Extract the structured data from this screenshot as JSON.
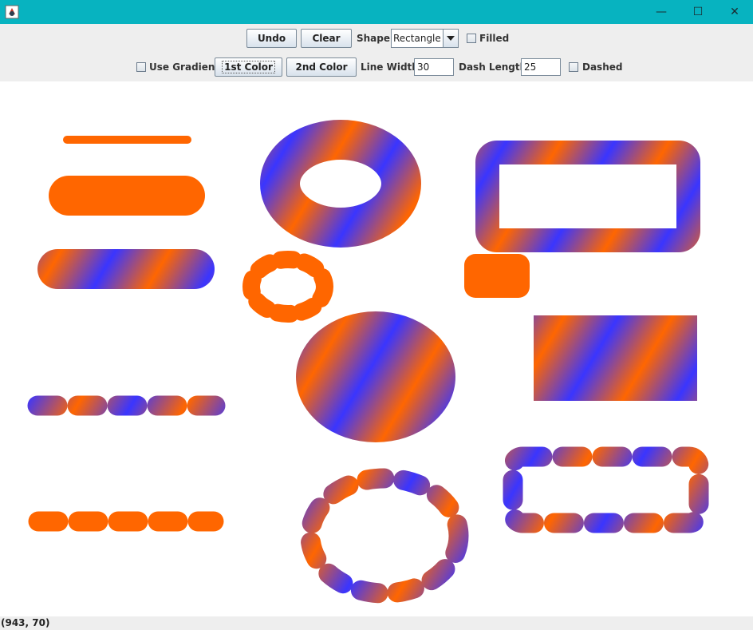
{
  "window": {
    "minimize_glyph": "—",
    "maximize_glyph": "☐",
    "close_glyph": "✕",
    "icon": "java-app-icon"
  },
  "toolbar": {
    "undo_label": "Undo",
    "clear_label": "Clear",
    "shape_label": "Shape:",
    "shape_value": "Rectangle",
    "filled_label": "Filled",
    "filled_checked": false,
    "use_gradient_label": "Use Gradient",
    "use_gradient_checked": false,
    "first_color_label": "1st Color",
    "second_color_label": "2nd Color",
    "line_width_label": "Line Width:",
    "line_width_value": "30",
    "dash_length_label": "Dash Length:",
    "dash_length_value": "25",
    "dashed_label": "Dashed",
    "dashed_checked": false
  },
  "colors": {
    "primary": "#ff6600",
    "secondary": "#3333ff",
    "titlebar": "#07b3c0"
  },
  "status": {
    "coordinates": "(943, 70)"
  }
}
